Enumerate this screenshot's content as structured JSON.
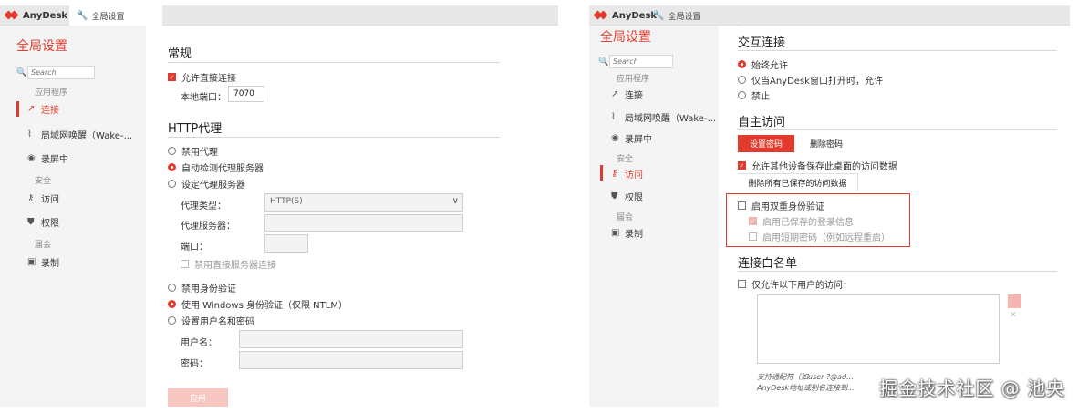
{
  "brand": "AnyDesk",
  "tab_label": "全局设置",
  "page_title": "全局设置",
  "search_placeholder": "Search",
  "sidebar": {
    "group_apps": "应用程序",
    "group_security": "安全",
    "group_session": "届会",
    "items": {
      "connection": "连接",
      "wol": "局域网唤醒（Wake-...",
      "recording_on": "录屏中",
      "access": "访问",
      "permissions": "权限",
      "recording": "录制"
    }
  },
  "left": {
    "general": {
      "title": "常规",
      "allow_direct": "允许直接连接",
      "port_label": "本地端口：",
      "port_value": "7070"
    },
    "proxy": {
      "title": "HTTP代理",
      "disable": "禁用代理",
      "auto": "自动检测代理服务器",
      "manual": "设定代理服务器",
      "type_label": "代理类型：",
      "type_value": "HTTP(S)",
      "server_label": "代理服务器：",
      "port_label": "端口：",
      "disable_direct": "禁用直接服务器连接"
    },
    "auth": {
      "disable": "禁用身份验证",
      "windows": "使用 Windows 身份验证（仅限 NTLM）",
      "userpass": "设置用户名和密码",
      "username_label": "用户名：",
      "password_label": "密码："
    },
    "apply": "应用"
  },
  "right": {
    "interactive": {
      "title": "交互连接",
      "always": "始终允许",
      "only_open": "仅当AnyDesk窗口打开时，允许",
      "disable": "禁止"
    },
    "unattended": {
      "title": "自主访问",
      "set_password": "设置密码",
      "delete_password": "删除密码",
      "allow_others_save": "允许其他设备保存此桌面的访问数据",
      "delete_saved": "删除所有已保存的访问数据"
    },
    "twofa": {
      "enable": "启用双重身份验证",
      "saved_login": "启用已保存的登录信息",
      "short_password": "启用短期密码（例如远程重启）"
    },
    "whitelist": {
      "title": "连接白名单",
      "only_following": "仅允许以下用户的访问：",
      "note_line1": "支持通配符（如user-?@ad...",
      "note_line2": "AnyDesk地址或别名连接到..."
    }
  },
  "watermark": "掘金技术社区 @ 池央"
}
